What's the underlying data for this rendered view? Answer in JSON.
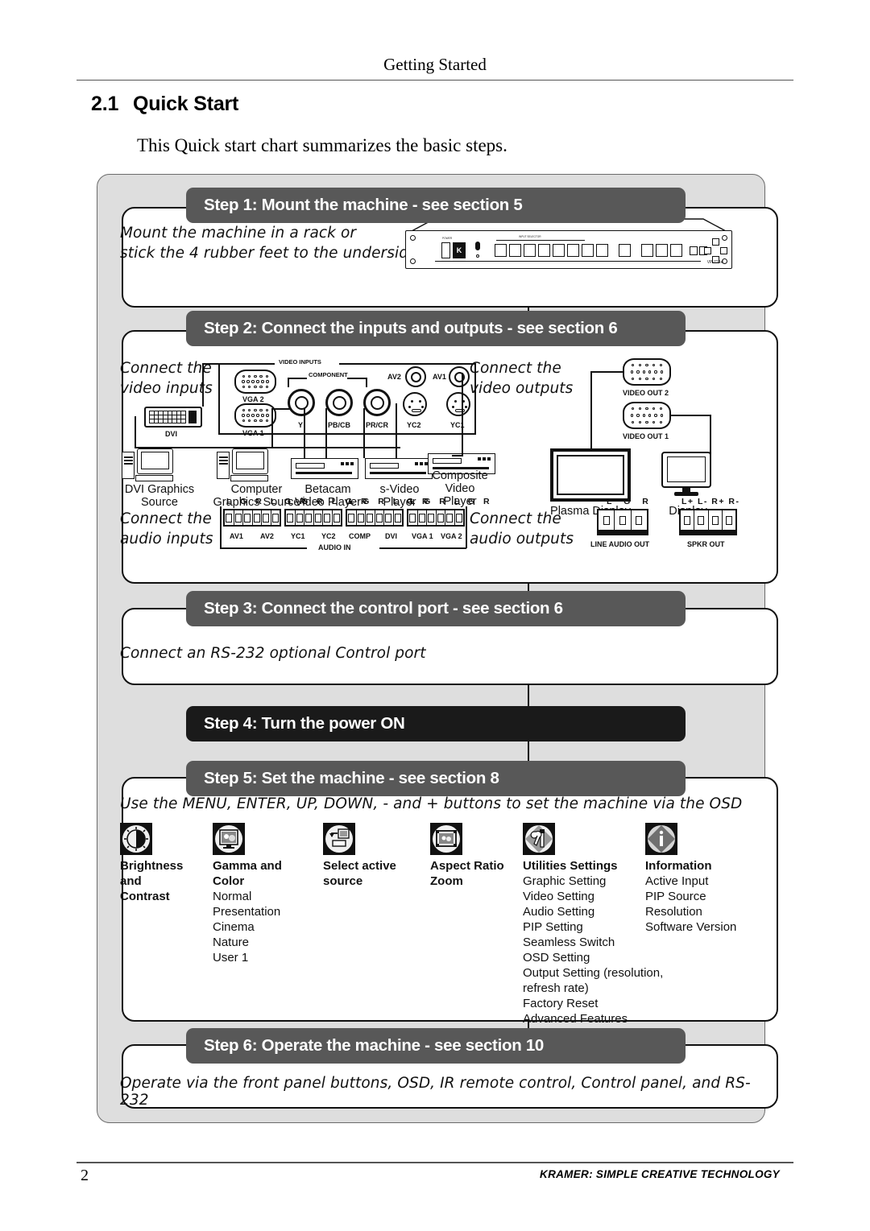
{
  "page": {
    "running_head": "Getting Started",
    "section_number": "2.1",
    "section_title": "Quick Start",
    "intro": "This Quick start chart summarizes the basic steps.",
    "page_number": "2",
    "footer_brand": "KRAMER:  SIMPLE CREATIVE TECHNOLOGY"
  },
  "steps": {
    "step1": {
      "bar": "Step 1: Mount the machine - see section 5",
      "line1": "Mount the machine in a rack or",
      "line2": "stick the 4 rubber feet to the underside",
      "device_model": "VP-724xl",
      "device_power_label": "POWER",
      "device_brand": "K"
    },
    "step2": {
      "bar": "Step 2: Connect the inputs and outputs - see section 6",
      "video_in_caption_l1": "Connect the",
      "video_in_caption_l2": "video inputs",
      "video_out_caption_l1": "Connect the",
      "video_out_caption_l2": "video outputs",
      "audio_in_caption_l1": "Connect the",
      "audio_in_caption_l2": "audio inputs",
      "audio_out_caption_l1": "Connect the",
      "audio_out_caption_l2": "audio outputs",
      "video_inputs_group": "VIDEO INPUTS",
      "component_group": "COMPONENT",
      "connectors": {
        "dvi": "DVI",
        "vga1": "VGA 1",
        "vga2": "VGA 2",
        "y": "Y",
        "pb": "PB/CB",
        "pr": "PR/CR",
        "yc2": "YC2",
        "yc1": "YC1",
        "av2": "AV2",
        "av1": "AV1",
        "video_out_2": "VIDEO OUT 2",
        "video_out_1": "VIDEO OUT 1"
      },
      "sources": {
        "dvi_src_l1": "DVI  Graphics",
        "dvi_src_l2": "Source",
        "computer_src_l1": "Computer",
        "computer_src_l2": "Graphics Source",
        "betacam_l1": "Betacam",
        "betacam_l2": "Video Player",
        "svideo_l1": "s-Video",
        "svideo_l2": "Player",
        "composite_l1": "Composite",
        "composite_l2": "Video",
        "composite_l3": "Player"
      },
      "displays": {
        "plasma": "Plasma Display",
        "display": "Display"
      },
      "audio_in": {
        "group": "AUDIO IN",
        "lgr": "L G R L G R",
        "labels": [
          "AV1",
          "AV2",
          "YC1",
          "YC2",
          "COMP",
          "DVI",
          "VGA 1",
          "VGA 2"
        ]
      },
      "audio_out": {
        "line_header": "L  G  R",
        "line_label": "LINE AUDIO OUT",
        "spkr_header": "L+ L- R+ R-",
        "spkr_label": "SPKR OUT"
      }
    },
    "step3": {
      "bar": "Step 3: Connect the control port - see section 6",
      "body": "Connect an RS-232 optional Control port"
    },
    "step4": {
      "bar": "Step 4: Turn the power ON"
    },
    "step5": {
      "bar": "Step 5: Set the machine - see section 8",
      "body": "Use the MENU, ENTER, UP, DOWN, - and + buttons to set the machine via the OSD",
      "columns": [
        {
          "icon": "brightness-contrast-icon",
          "title": "Brightness and Contrast",
          "title_lines": [
            "Brightness",
            "and",
            "Contrast"
          ],
          "items": []
        },
        {
          "icon": "gamma-color-icon",
          "title": "Gamma and Color",
          "title_lines": [
            "Gamma and",
            "Color"
          ],
          "items": [
            "Normal",
            "Presentation",
            "Cinema",
            "Nature",
            "User 1"
          ]
        },
        {
          "icon": "select-source-icon",
          "title": "Select active source",
          "title_lines": [
            "Select active",
            "source"
          ],
          "items": []
        },
        {
          "icon": "aspect-ratio-icon",
          "title": "Aspect Ratio Zoom",
          "title_lines": [
            "Aspect Ratio",
            "Zoom"
          ],
          "items": []
        },
        {
          "icon": "utilities-settings-icon",
          "title": "Utilities Settings",
          "title_lines": [
            "Utilities Settings"
          ],
          "items": [
            "Graphic Setting",
            "Video Setting",
            "Audio Setting",
            "PIP Setting",
            "Seamless Switch",
            "OSD Setting",
            "Output Setting (resolution, refresh rate)",
            "Factory Reset",
            "Advanced Features"
          ],
          "italic_part": "resolution, refresh rate"
        },
        {
          "icon": "information-icon",
          "title": "Information",
          "title_lines": [
            "Information"
          ],
          "items": [
            "Active Input",
            "PIP Source",
            "Resolution",
            "Software Version"
          ]
        }
      ]
    },
    "step6": {
      "bar": "Step 6: Operate the machine - see section 10",
      "body": "Operate via the front panel buttons, OSD, IR remote control, Control panel, and RS-232"
    }
  },
  "colors": {
    "bar_grey": "#585858",
    "bar_black": "#1a1a1a",
    "container_grey": "#dedede",
    "ink": "#111111"
  }
}
